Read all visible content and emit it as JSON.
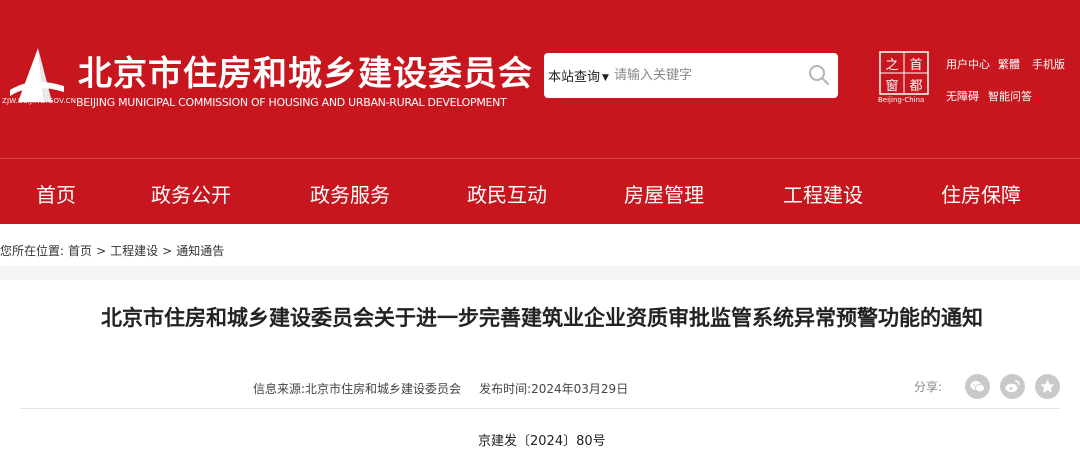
{
  "header": {
    "title": "北京市住房和城乡建设委员会",
    "subtitle": "BEIJING MUNICIPAL COMMISSION OF HOUSING AND URBAN-RURAL DEVELOPMENT",
    "domain": "ZJW.BEIJING.GOV.CN",
    "brand_color": "#c8161e"
  },
  "search": {
    "scope_label": "本站查询",
    "placeholder": "请输入关键字"
  },
  "capital_badge": {
    "chars": [
      "之",
      "首",
      "都",
      "窗"
    ],
    "caption": "Beijing-China"
  },
  "utility_links": {
    "user_center": "用户中心",
    "traditional": "繁體",
    "mobile": "手机版",
    "accessibility": "无障碍",
    "smart_qa": "智能问答"
  },
  "nav": {
    "items": [
      "首页",
      "政务公开",
      "政务服务",
      "政民互动",
      "房屋管理",
      "工程建设",
      "住房保障"
    ]
  },
  "breadcrumb": {
    "prefix": "您所在位置:",
    "items": [
      "首页",
      ">",
      "工程建设",
      ">",
      "通知通告"
    ]
  },
  "article": {
    "title": "北京市住房和城乡建设委员会关于进一步完善建筑业企业资质审批监管系统异常预警功能的通知",
    "source_label": "信息来源:",
    "source": "北京市住房和城乡建设委员会",
    "date_label": "发布时间:",
    "date": "2024年03月29日",
    "share_label": "分享:",
    "doc_number": "京建发〔2024〕80号"
  },
  "icons": {
    "logo": "tower-logo-icon",
    "search": "search-icon",
    "share": [
      "wechat-icon",
      "weibo-icon",
      "favorite-icon"
    ]
  }
}
